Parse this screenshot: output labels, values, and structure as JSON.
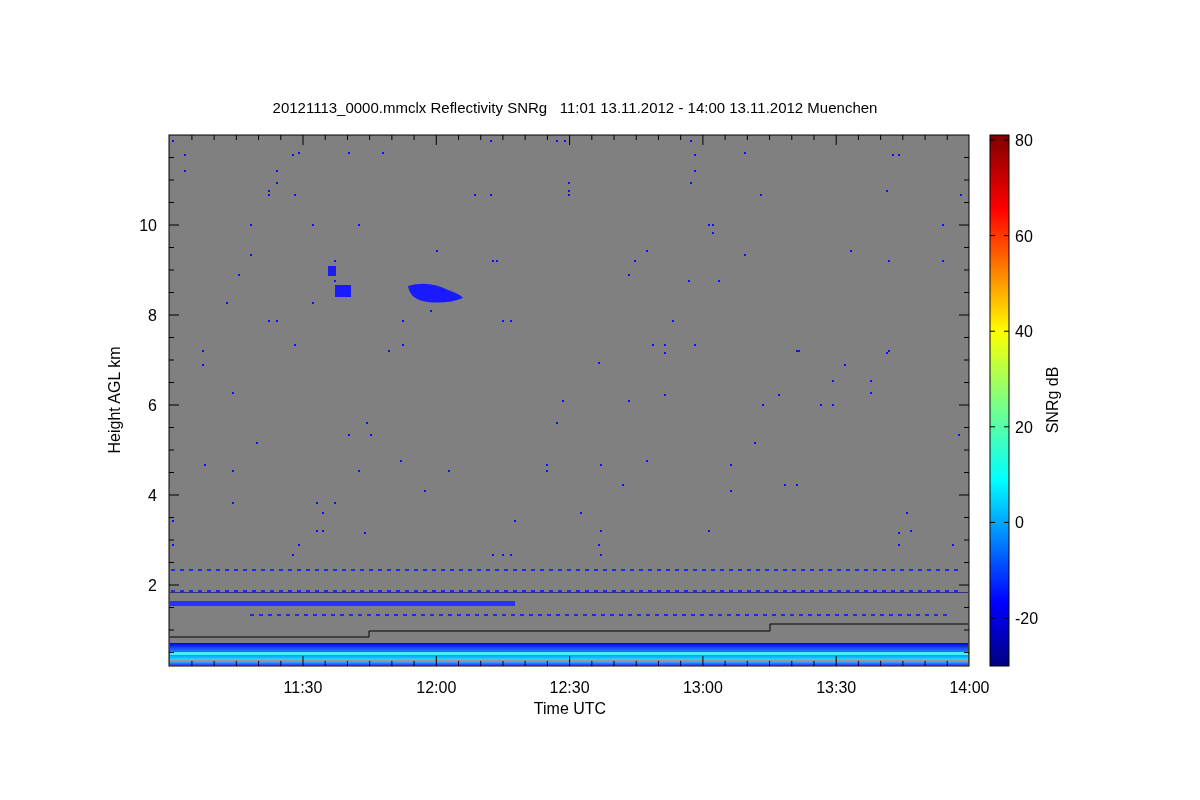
{
  "figure": {
    "title": "20121113_0000.mmclx Reflectivity SNRg   11:01 13.11.2012 - 14:00 13.11.2012 Muenchen",
    "plot": {
      "ylabel": "Height AGL km",
      "xlabel": "Time UTC",
      "yticks": [
        "10",
        "8",
        "6",
        "4",
        "2"
      ],
      "xticks": [
        "11:30",
        "12:00",
        "12:30",
        "13:00",
        "13:30",
        "14:00"
      ]
    },
    "colorbar": {
      "label": "SNRg dB",
      "ticks": [
        "80",
        "60",
        "40",
        "20",
        "0",
        "-20"
      ]
    }
  }
}
